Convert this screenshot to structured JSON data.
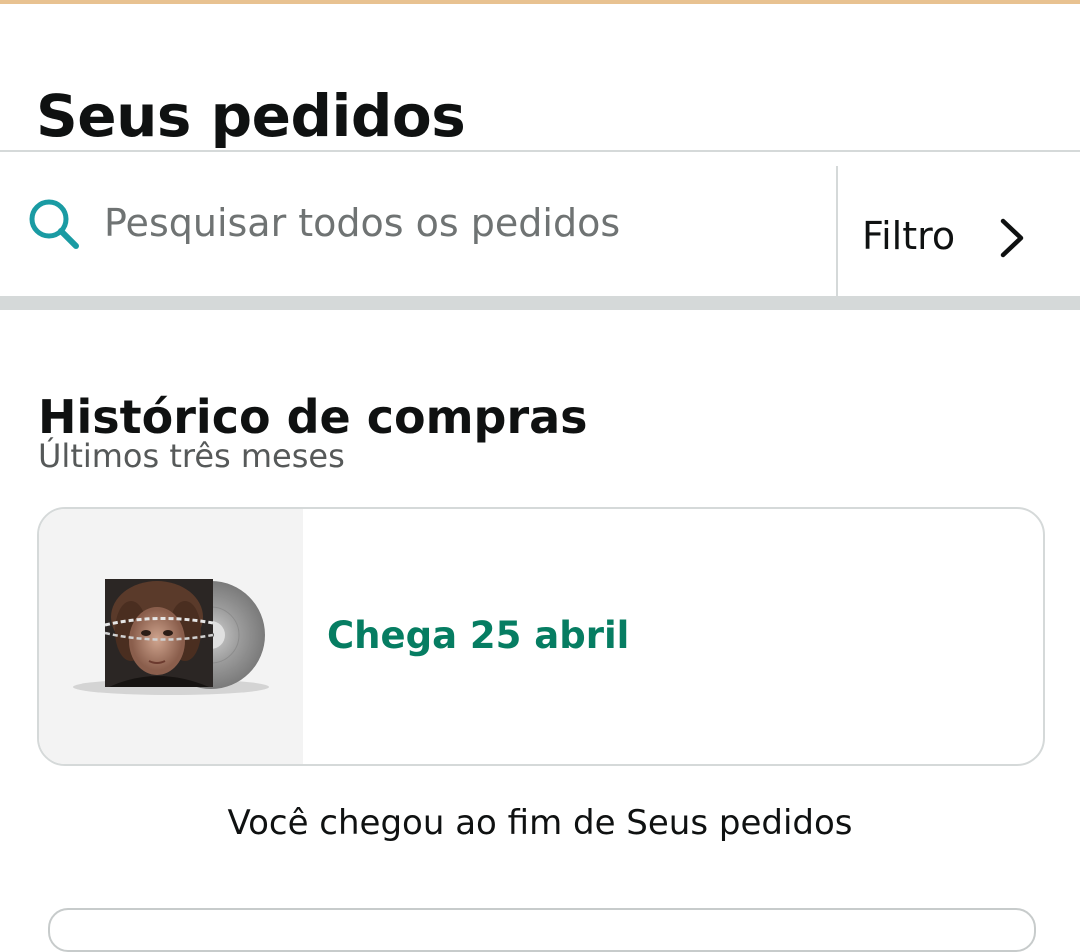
{
  "colors": {
    "accent_top": "#e8c291",
    "search_icon": "#1a9ba3",
    "delivery_status": "#067d62",
    "divider": "#d5d9d9",
    "subtitle_text": "#565959"
  },
  "header": {
    "title": "Seus pedidos"
  },
  "search": {
    "placeholder": "Pesquisar todos os pedidos",
    "icon": "search-icon"
  },
  "filter": {
    "label": "Filtro",
    "icon": "chevron-right-icon"
  },
  "history": {
    "title": "Histórico de compras",
    "subtitle": "Últimos três meses",
    "orders": [
      {
        "image": "vinyl-album-cover",
        "status": "Chega 25 abril"
      }
    ]
  },
  "end_message": "Você chegou ao fim de Seus pedidos"
}
